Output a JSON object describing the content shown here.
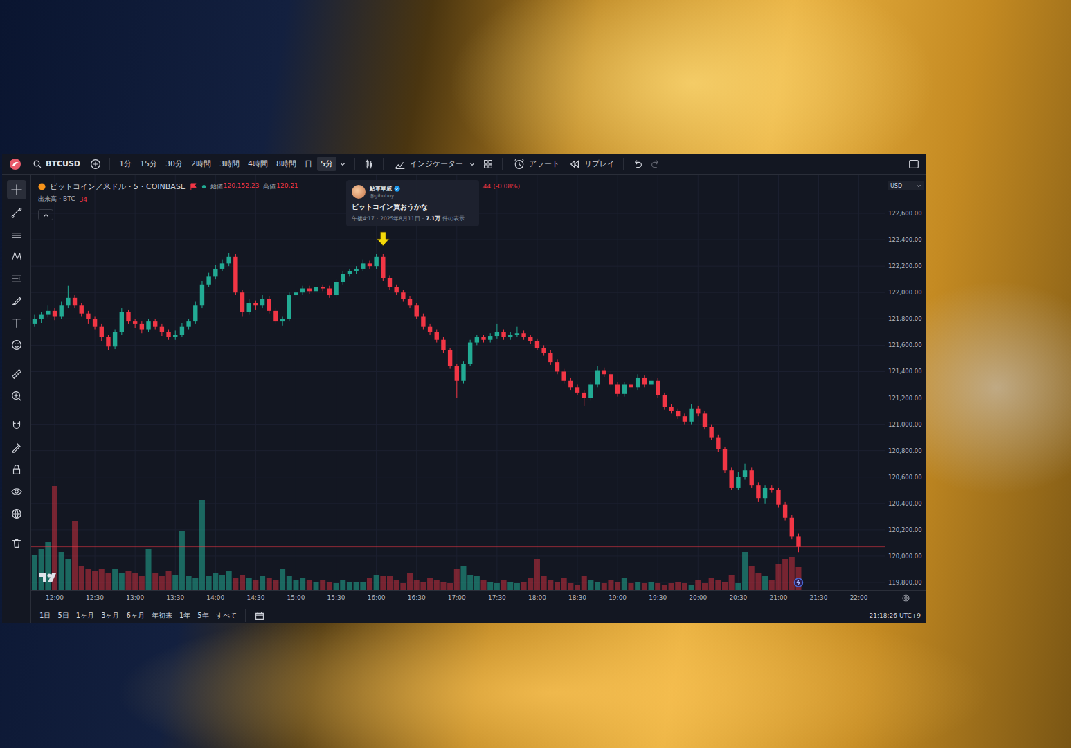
{
  "toolbar": {
    "symbol": "BTCUSD",
    "intervals": [
      {
        "label": "1分",
        "selected": false
      },
      {
        "label": "15分",
        "selected": false
      },
      {
        "label": "30分",
        "selected": false
      },
      {
        "label": "2時間",
        "selected": false
      },
      {
        "label": "3時間",
        "selected": false
      },
      {
        "label": "4時間",
        "selected": false
      },
      {
        "label": "8時間",
        "selected": false
      },
      {
        "label": "日",
        "selected": false
      },
      {
        "label": "5分",
        "selected": true
      }
    ],
    "indicators": "インジケーター",
    "alert": "アラート",
    "replay": "リプレイ"
  },
  "left_tools": [
    {
      "selected": true
    },
    {
      "selected": false
    },
    {
      "selected": false
    },
    {
      "selected": false
    },
    {
      "selected": false
    },
    {
      "selected": false
    },
    {
      "selected": false
    },
    {
      "selected": false
    },
    {
      "selected": false
    },
    {
      "selected": false
    },
    {
      "selected": false
    },
    {
      "selected": false
    },
    {
      "selected": false
    },
    {
      "selected": false
    },
    {
      "selected": false
    },
    {
      "selected": false
    }
  ],
  "legend": {
    "title": "ビットコイン／米ドル・5・COINBASE",
    "open_label": "始値",
    "open": "120,152.23",
    "high_label": "高値",
    "high": "120,21",
    "tail": ".44 (-0.08%)",
    "volume_label": "出来高・BTC",
    "volume": "34"
  },
  "tweet": {
    "name": "鮎草皐威",
    "handle": "@gihuboy",
    "text": "ビットコイン買おうかな",
    "time": "午後4:17",
    "separator": "·",
    "date": "2025年8月11日",
    "views": "7.1万",
    "views_label": "件の表示"
  },
  "currency": "USD",
  "chart": {
    "price_ticks": [
      {
        "label": "122,600.00",
        "value": 122600
      },
      {
        "label": "122,400.00",
        "value": 122400
      },
      {
        "label": "122,200.00",
        "value": 122200
      },
      {
        "label": "122,000.00",
        "value": 122000
      },
      {
        "label": "121,800.00",
        "value": 121800
      },
      {
        "label": "121,600.00",
        "value": 121600
      },
      {
        "label": "121,400.00",
        "value": 121400
      },
      {
        "label": "121,200.00",
        "value": 121200
      },
      {
        "label": "121,000.00",
        "value": 121000
      },
      {
        "label": "120,800.00",
        "value": 120800
      },
      {
        "label": "120,600.00",
        "value": 120600
      },
      {
        "label": "120,400.00",
        "value": 120400
      },
      {
        "label": "120,200.00",
        "value": 120200
      },
      {
        "label": "120,000.00",
        "value": 120000
      },
      {
        "label": "119,800.00",
        "value": 119800
      }
    ],
    "time_ticks": [
      {
        "label": "12:00",
        "index": 3
      },
      {
        "label": "12:30",
        "index": 9
      },
      {
        "label": "13:00",
        "index": 15
      },
      {
        "label": "13:30",
        "index": 21
      },
      {
        "label": "14:00",
        "index": 27
      },
      {
        "label": "14:30",
        "index": 33
      },
      {
        "label": "15:00",
        "index": 39
      },
      {
        "label": "15:30",
        "index": 45
      },
      {
        "label": "16:00",
        "index": 51
      },
      {
        "label": "16:30",
        "index": 57
      },
      {
        "label": "17:00",
        "index": 63
      },
      {
        "label": "17:30",
        "index": 69
      },
      {
        "label": "18:00",
        "index": 75
      },
      {
        "label": "18:30",
        "index": 81
      },
      {
        "label": "19:00",
        "index": 87
      },
      {
        "label": "19:30",
        "index": 93
      },
      {
        "label": "20:00",
        "index": 99
      },
      {
        "label": "20:30",
        "index": 105
      },
      {
        "label": "21:00",
        "index": 111
      },
      {
        "label": "21:30",
        "index": 117
      },
      {
        "label": "22:00",
        "index": 123
      }
    ],
    "candles": [
      [
        121760,
        121830,
        121740,
        121800
      ],
      [
        121800,
        121850,
        121770,
        121830
      ],
      [
        121830,
        121900,
        121810,
        121860
      ],
      [
        121860,
        121880,
        121790,
        121820
      ],
      [
        121820,
        121930,
        121800,
        121900
      ],
      [
        121900,
        122050,
        121880,
        121960
      ],
      [
        121960,
        121980,
        121880,
        121900
      ],
      [
        121900,
        121920,
        121820,
        121840
      ],
      [
        121840,
        121860,
        121760,
        121800
      ],
      [
        121800,
        121820,
        121720,
        121740
      ],
      [
        121740,
        121760,
        121630,
        121660
      ],
      [
        121660,
        121680,
        121560,
        121590
      ],
      [
        121590,
        121720,
        121570,
        121700
      ],
      [
        121700,
        121880,
        121680,
        121850
      ],
      [
        121850,
        121870,
        121760,
        121780
      ],
      [
        121780,
        121800,
        121730,
        121760
      ],
      [
        121760,
        121780,
        121690,
        121720
      ],
      [
        121720,
        121800,
        121700,
        121780
      ],
      [
        121780,
        121800,
        121720,
        121740
      ],
      [
        121740,
        121760,
        121670,
        121700
      ],
      [
        121700,
        121720,
        121640,
        121660
      ],
      [
        121660,
        121710,
        121640,
        121680
      ],
      [
        121680,
        121770,
        121660,
        121740
      ],
      [
        121740,
        121800,
        121720,
        121780
      ],
      [
        121780,
        121930,
        121760,
        121900
      ],
      [
        121900,
        122090,
        121880,
        122060
      ],
      [
        122060,
        122150,
        122040,
        122120
      ],
      [
        122120,
        122210,
        122100,
        122180
      ],
      [
        122180,
        122250,
        122160,
        122220
      ],
      [
        122220,
        122300,
        122200,
        122270
      ],
      [
        122270,
        122290,
        121980,
        122000
      ],
      [
        122000,
        122020,
        121820,
        121850
      ],
      [
        121850,
        121950,
        121830,
        121920
      ],
      [
        121920,
        121940,
        121870,
        121900
      ],
      [
        121900,
        121980,
        121880,
        121950
      ],
      [
        121950,
        121970,
        121840,
        121860
      ],
      [
        121860,
        121880,
        121760,
        121780
      ],
      [
        121780,
        121820,
        121750,
        121800
      ],
      [
        121800,
        122000,
        121780,
        121980
      ],
      [
        121980,
        122020,
        121960,
        122000
      ],
      [
        122000,
        122050,
        121980,
        122030
      ],
      [
        122030,
        122050,
        121990,
        122010
      ],
      [
        122010,
        122060,
        121990,
        122040
      ],
      [
        122040,
        122060,
        122010,
        122030
      ],
      [
        122030,
        122050,
        121960,
        121980
      ],
      [
        121980,
        122100,
        121960,
        122080
      ],
      [
        122080,
        122160,
        122060,
        122140
      ],
      [
        122140,
        122180,
        122120,
        122160
      ],
      [
        122160,
        122200,
        122140,
        122180
      ],
      [
        122180,
        122250,
        122160,
        122220
      ],
      [
        122220,
        122240,
        122180,
        122200
      ],
      [
        122200,
        122290,
        122180,
        122270
      ],
      [
        122270,
        122290,
        122090,
        122110
      ],
      [
        122110,
        122130,
        122020,
        122040
      ],
      [
        122040,
        122060,
        121980,
        122000
      ],
      [
        122000,
        122020,
        121930,
        121950
      ],
      [
        121950,
        121970,
        121880,
        121900
      ],
      [
        121900,
        121920,
        121800,
        121820
      ],
      [
        121820,
        121840,
        121720,
        121740
      ],
      [
        121740,
        121760,
        121680,
        121700
      ],
      [
        121700,
        121720,
        121620,
        121640
      ],
      [
        121640,
        121660,
        121540,
        121560
      ],
      [
        121560,
        121580,
        121420,
        121440
      ],
      [
        121440,
        121460,
        121200,
        121330
      ],
      [
        121330,
        121480,
        121310,
        121460
      ],
      [
        121460,
        121640,
        121440,
        121620
      ],
      [
        121620,
        121680,
        121600,
        121660
      ],
      [
        121660,
        121680,
        121620,
        121640
      ],
      [
        121640,
        121690,
        121620,
        121670
      ],
      [
        121670,
        121760,
        121650,
        121700
      ],
      [
        121700,
        121720,
        121640,
        121660
      ],
      [
        121660,
        121700,
        121640,
        121680
      ],
      [
        121680,
        121740,
        121660,
        121690
      ],
      [
        121690,
        121710,
        121640,
        121660
      ],
      [
        121660,
        121680,
        121610,
        121630
      ],
      [
        121630,
        121650,
        121560,
        121580
      ],
      [
        121580,
        121600,
        121520,
        121540
      ],
      [
        121540,
        121560,
        121450,
        121470
      ],
      [
        121470,
        121490,
        121380,
        121400
      ],
      [
        121400,
        121420,
        121310,
        121330
      ],
      [
        121330,
        121350,
        121260,
        121280
      ],
      [
        121280,
        121300,
        121220,
        121240
      ],
      [
        121240,
        121260,
        121140,
        121200
      ],
      [
        121200,
        121320,
        121180,
        121300
      ],
      [
        121300,
        121440,
        121280,
        121410
      ],
      [
        121410,
        121430,
        121360,
        121380
      ],
      [
        121380,
        121400,
        121280,
        121300
      ],
      [
        121300,
        121320,
        121210,
        121230
      ],
      [
        121230,
        121320,
        121210,
        121300
      ],
      [
        121300,
        121320,
        121260,
        121280
      ],
      [
        121280,
        121380,
        121260,
        121350
      ],
      [
        121350,
        121370,
        121280,
        121300
      ],
      [
        121300,
        121360,
        121280,
        121330
      ],
      [
        121330,
        121350,
        121200,
        121220
      ],
      [
        121220,
        121240,
        121110,
        121130
      ],
      [
        121130,
        121150,
        121080,
        121100
      ],
      [
        121100,
        121120,
        121040,
        121060
      ],
      [
        121060,
        121080,
        121000,
        121020
      ],
      [
        121020,
        121150,
        121000,
        121120
      ],
      [
        121120,
        121140,
        121060,
        121080
      ],
      [
        121080,
        121100,
        120960,
        120980
      ],
      [
        120980,
        121000,
        120880,
        120900
      ],
      [
        120900,
        120920,
        120790,
        120810
      ],
      [
        120810,
        120830,
        120630,
        120650
      ],
      [
        120650,
        120670,
        120500,
        120520
      ],
      [
        120520,
        120640,
        120500,
        120600
      ],
      [
        120600,
        120700,
        120580,
        120650
      ],
      [
        120650,
        120670,
        120520,
        120540
      ],
      [
        120540,
        120560,
        120410,
        120440
      ],
      [
        120440,
        120540,
        120400,
        120520
      ],
      [
        120520,
        120540,
        120480,
        120500
      ],
      [
        120500,
        120520,
        120370,
        120390
      ],
      [
        120390,
        120410,
        120270,
        120290
      ],
      [
        120290,
        120310,
        120130,
        120150
      ],
      [
        120150,
        120170,
        120030,
        120070
      ]
    ],
    "volume": [
      50,
      60,
      70,
      150,
      55,
      45,
      100,
      35,
      30,
      28,
      30,
      25,
      30,
      25,
      28,
      25,
      20,
      60,
      25,
      20,
      28,
      22,
      85,
      20,
      18,
      130,
      20,
      25,
      22,
      28,
      18,
      22,
      18,
      15,
      20,
      18,
      15,
      30,
      20,
      15,
      18,
      15,
      12,
      15,
      12,
      10,
      15,
      12,
      12,
      12,
      18,
      22,
      20,
      20,
      15,
      10,
      25,
      15,
      12,
      18,
      15,
      12,
      10,
      30,
      35,
      22,
      20,
      15,
      12,
      10,
      15,
      12,
      10,
      12,
      18,
      45,
      20,
      15,
      12,
      18,
      10,
      8,
      20,
      15,
      12,
      10,
      15,
      12,
      18,
      10,
      12,
      10,
      12,
      10,
      8,
      10,
      12,
      10,
      8,
      15,
      10,
      18,
      15,
      12,
      22,
      10,
      55,
      35,
      25,
      20,
      15,
      38,
      45,
      48,
      34
    ],
    "last_price": 120070,
    "marker_index": 52
  },
  "ranges": [
    "1日",
    "5日",
    "1ヶ月",
    "3ヶ月",
    "6ヶ月",
    "年初来",
    "1年",
    "5年",
    "すべて"
  ],
  "clock": "21:18:26 UTC+9"
}
